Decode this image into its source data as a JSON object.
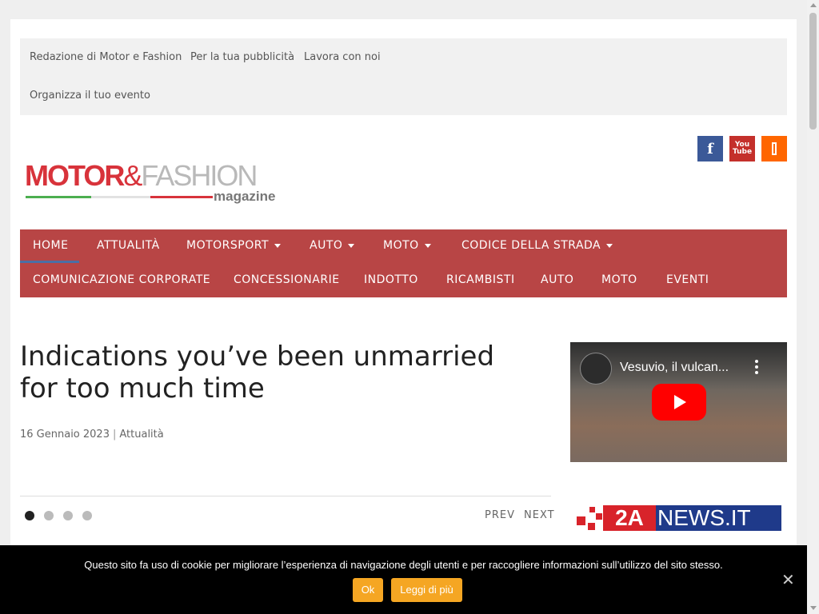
{
  "topbar": {
    "links": [
      "Redazione di Motor e Fashion",
      "Per la tua pubblicità",
      "Lavora con noi",
      "Organizza il tuo evento"
    ]
  },
  "social": {
    "facebook_glyph": "f",
    "youtube_you": "You",
    "youtube_tube": "Tube",
    "icons": [
      "facebook-icon",
      "youtube-icon",
      "rss-icon"
    ],
    "colors": {
      "facebook": "#3b5998",
      "youtube": "#c4302b",
      "rss": "#ff6600"
    }
  },
  "logo": {
    "motor": "MOTOR",
    "amp": "&",
    "fashion": "FASHION",
    "magazine": "magazine"
  },
  "nav": {
    "row1": [
      {
        "label": "HOME",
        "dropdown": false
      },
      {
        "label": "ATTUALITÀ",
        "dropdown": false
      },
      {
        "label": "MOTORSPORT",
        "dropdown": true
      },
      {
        "label": "AUTO",
        "dropdown": true
      },
      {
        "label": "MOTO",
        "dropdown": true
      },
      {
        "label": "CODICE DELLA STRADA",
        "dropdown": true
      }
    ],
    "row2": [
      "COMUNICAZIONE CORPORATE",
      "CONCESSIONARIE",
      "INDOTTO",
      "RICAMBISTI",
      "AUTO",
      "MOTO",
      "EVENTI"
    ],
    "color": "#b84545"
  },
  "article": {
    "title": "Indications you’ve been unmarried for too much time",
    "date": "16 Gennaio 2023",
    "separator": "|",
    "category": "Attualità"
  },
  "slider": {
    "dot_count": 4,
    "active_dot": 1,
    "prev": "PREV",
    "next": "NEXT"
  },
  "video": {
    "title": "Vesuvio, il vulcan..."
  },
  "sidebar": {
    "news_logo_2a": "2A",
    "news_logo_text": "NEWS.IT"
  },
  "cookie": {
    "text": "Questo sito fa uso di cookie per migliorare l’esperienza di navigazione degli utenti e per raccogliere informazioni sull’utilizzo del sito stesso.",
    "ok": "Ok",
    "more": "Leggi di più",
    "close": "✕",
    "button_color": "#f5a623"
  }
}
